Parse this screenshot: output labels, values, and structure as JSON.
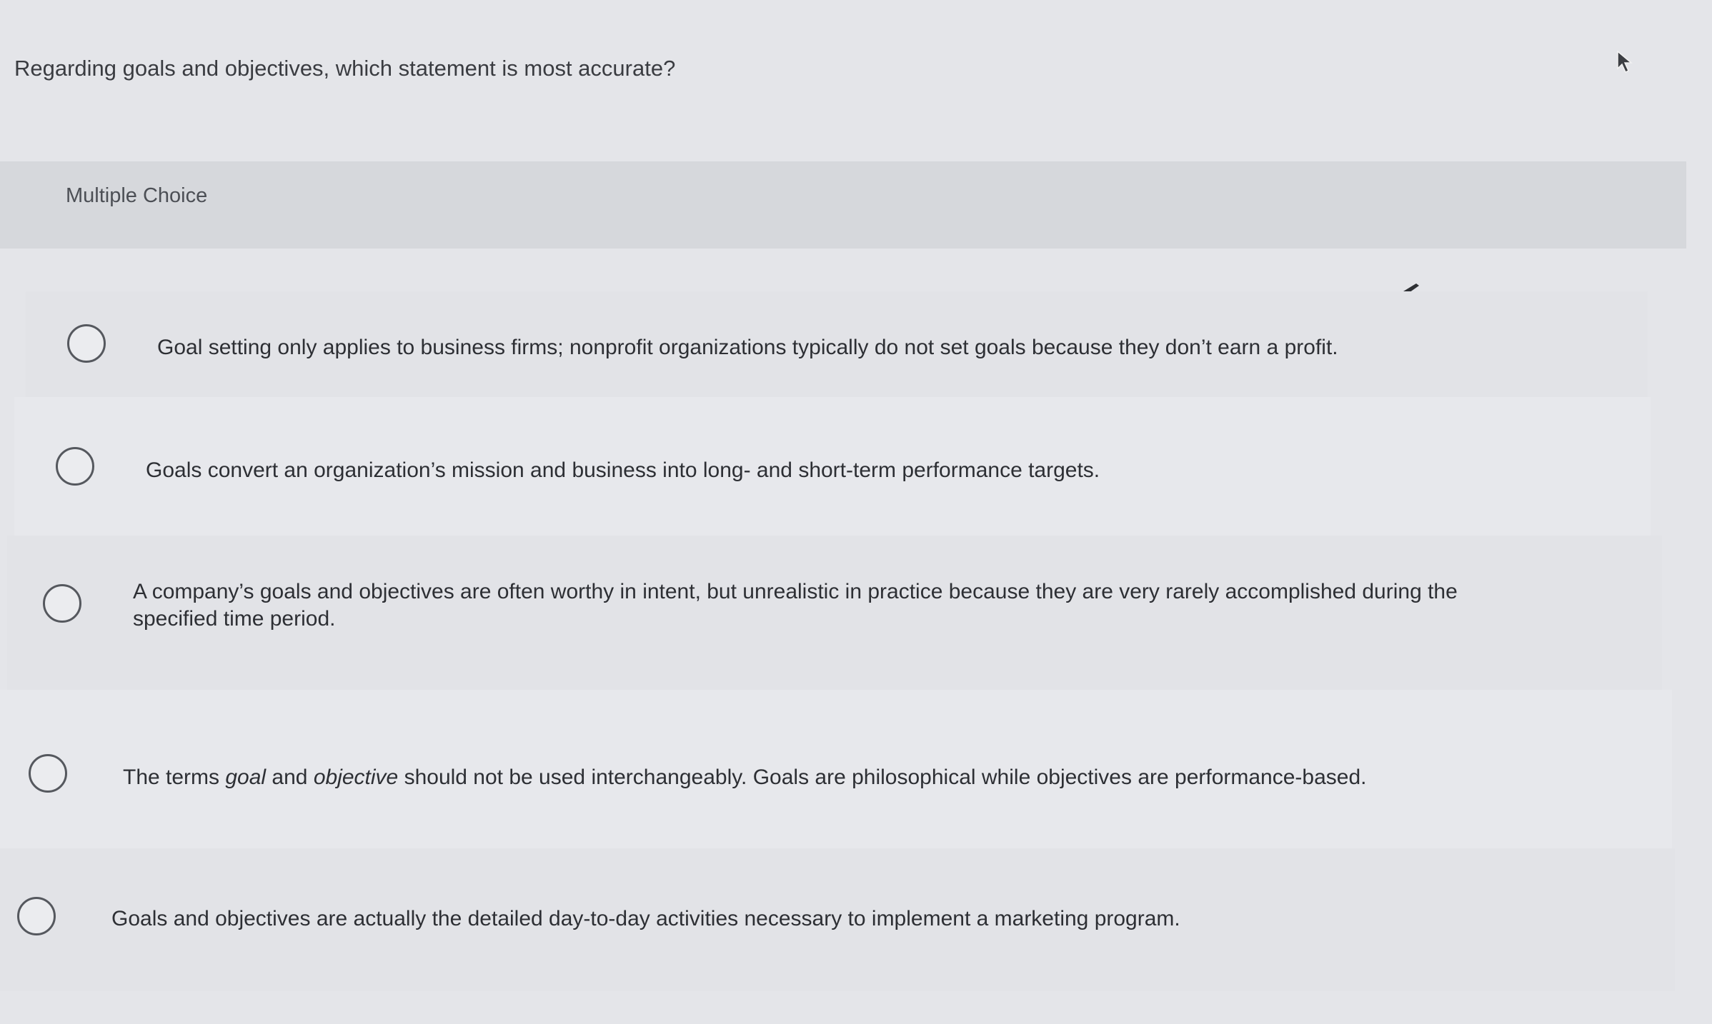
{
  "question": {
    "text": "Regarding goals and objectives, which statement is most accurate?"
  },
  "section": {
    "label": "Multiple Choice"
  },
  "choices": [
    {
      "text": "Goal setting only applies to business firms; nonprofit organizations typically do not set goals because they don’t earn a profit."
    },
    {
      "text": "Goals convert an organization’s mission and business into long- and short-term performance targets."
    },
    {
      "text": "A company’s goals and objectives are often worthy in intent, but unrealistic in practice because they are very rarely accomplished during the specified time period."
    },
    {
      "parts": [
        "The terms ",
        "goal",
        " and ",
        "objective",
        " should not be used interchangeably. Goals are philosophical while objectives are performance-based."
      ]
    },
    {
      "text": "Goals and objectives are actually the detailed day-to-day activities necessary to implement a marketing program."
    }
  ],
  "icons": {
    "pen": "pen-icon",
    "cursor": "cursor-icon",
    "radio": "radio-unselected-icon"
  },
  "colors": {
    "background": "#e4e5e9",
    "header_band": "#d6d8dc",
    "text": "#2d2f34",
    "radio_border": "#55585e"
  }
}
